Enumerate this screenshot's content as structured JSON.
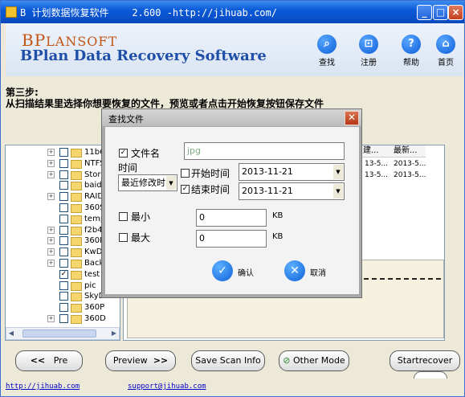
{
  "window": {
    "title": "B 计划数据恢复软件    2.600 -http://jihuab.com/",
    "minimize": "_",
    "maximize": "□",
    "close": "×"
  },
  "banner": {
    "logo_top_first": "BP",
    "logo_top_rest": "LANSOFT",
    "logo_name": "BPlan Data Recovery Software",
    "nav": [
      {
        "label": "查找",
        "icon": "search-icon",
        "glyph": "⌕"
      },
      {
        "label": "注册",
        "icon": "cart-icon",
        "glyph": "⊡"
      },
      {
        "label": "帮助",
        "icon": "help-icon",
        "glyph": "?"
      },
      {
        "label": "首页",
        "icon": "home-icon",
        "glyph": "⌂"
      }
    ]
  },
  "step": {
    "line1": "第三步:",
    "line2": "从扫描结果里选择你想要恢复的文件，预览或者点击开始恢复按钮保存文件"
  },
  "tree": {
    "items": [
      {
        "label": "11b63",
        "checked": false,
        "expand": "+"
      },
      {
        "label": "NTFS",
        "checked": false,
        "expand": "+"
      },
      {
        "label": "Storm",
        "checked": false,
        "expand": "+"
      },
      {
        "label": "baidu",
        "checked": false,
        "expand": ""
      },
      {
        "label": "RAID",
        "checked": false,
        "expand": "+"
      },
      {
        "label": "360S",
        "checked": false,
        "expand": ""
      },
      {
        "label": "temp",
        "checked": false,
        "expand": ""
      },
      {
        "label": "f2b44",
        "checked": false,
        "expand": "+"
      },
      {
        "label": "360R",
        "checked": false,
        "expand": "+"
      },
      {
        "label": "KwDo",
        "checked": false,
        "expand": "+"
      },
      {
        "label": "BackI",
        "checked": false,
        "expand": "+"
      },
      {
        "label": "test",
        "checked": true,
        "expand": ""
      },
      {
        "label": "pic",
        "checked": false,
        "expand": ""
      },
      {
        "label": "SkyD",
        "checked": false,
        "expand": ""
      },
      {
        "label": "360P",
        "checked": false,
        "expand": ""
      },
      {
        "label": "360D",
        "checked": false,
        "expand": "+"
      }
    ]
  },
  "filelist": {
    "headers": [
      "建...",
      "最新..."
    ],
    "rows": [
      [
        "13-5...",
        "2013-5..."
      ],
      [
        "13-5...",
        "2013-5..."
      ]
    ]
  },
  "buttons": {
    "prev": "Pre",
    "preview": "Preview",
    "save_scan": "Save Scan Info",
    "other_mode": "Other Mode",
    "start": "Startrecover"
  },
  "links": {
    "site": "http://jihuab.com",
    "support": "support@jihuab.com"
  },
  "dialog": {
    "title": "查找文件",
    "filename_label": "文件名",
    "filename_checked": true,
    "filename_value": "jpg",
    "time_label": "时间",
    "time_mode": "最近修改时",
    "start_time_label": "开始时间",
    "start_time_checked": false,
    "start_date": "2013-11-21",
    "end_time_label": "结束时间",
    "end_time_checked": true,
    "end_date": "2013-11-21",
    "min_label": "最小",
    "min_checked": false,
    "min_value": "0",
    "min_unit": "KB",
    "max_label": "最大",
    "max_checked": false,
    "max_value": "0",
    "max_unit": "KB",
    "ok_label": "确认",
    "cancel_label": "取消",
    "colors": {
      "filename_value": "#7fb07f",
      "round_button": "#1161d8"
    }
  }
}
